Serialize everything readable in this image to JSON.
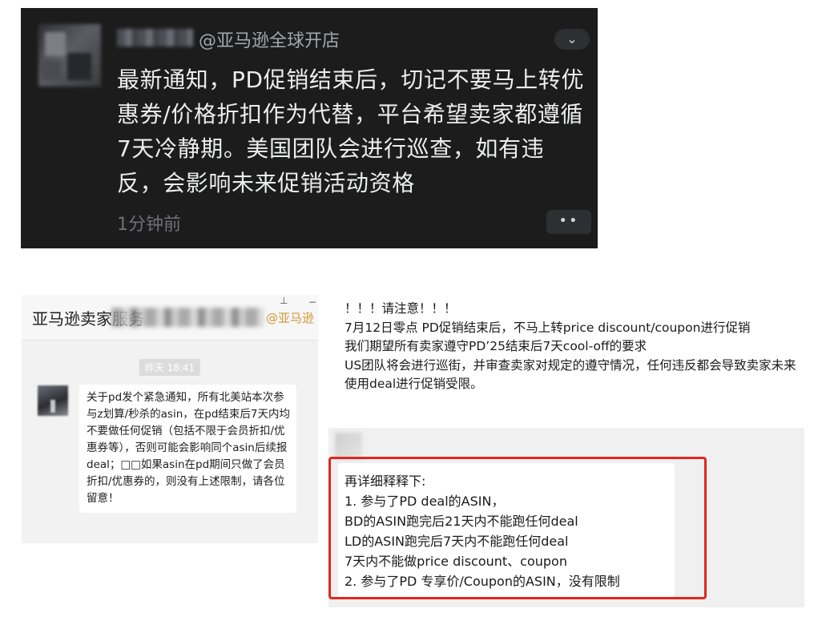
{
  "dark_post": {
    "mention": "@亚马逊全球开店",
    "message": "最新通知，PD促销结束后，切记不要马上转优惠券/价格折扣作为代替，平台希望卖家都遵循7天冷静期。美国团队会进行巡查，如有违反，会影响未来促销活动资格",
    "time": "1分钟前",
    "chevron_icon": "chevron-down-icon",
    "more_icon": "more-dots-icon",
    "chevron_glyph": "⌄",
    "more_glyph": "••"
  },
  "group_chat": {
    "title": "亚马逊卖家服务",
    "mention": "@亚马逊",
    "pin_glyph": "⊥",
    "dash_glyph": "−",
    "timestamp": "昨天 18:41",
    "message": "关于pd发个紧急通知，所有北美站本次参与z划算/秒杀的asin，在pd结束后7天内均不要做任何促销（包括不限于会员折扣/优惠券等），否则可能会影响同个asin后续报deal；□□如果asin在pd期间只做了会员折扣/优惠券的，则没有上述限制，请各位留意！"
  },
  "notice": {
    "lines": [
      "！！！请注意！！！",
      "7月12日零点 PD促销结束后，不马上转price discount/coupon进行促销",
      "我们期望所有卖家遵守PD’25结束后7天cool-off的要求",
      "US团队将会进行巡街，并审查卖家对规定的遵守情况，任何违反都会导致卖家未来使用deal进行促销受限。"
    ],
    "detail_lines": [
      "再详细释释下:",
      "1. 参与了PD deal的ASIN，",
      "BD的ASIN跑完后21天内不能跑任何deal",
      "LD的ASIN跑完后7天内不能跑任何deal",
      "7天内不能做price discount、coupon",
      "2. 参与了PD 专享价/Coupon的ASIN，没有限制"
    ],
    "highlight_color": "#e0271e"
  }
}
